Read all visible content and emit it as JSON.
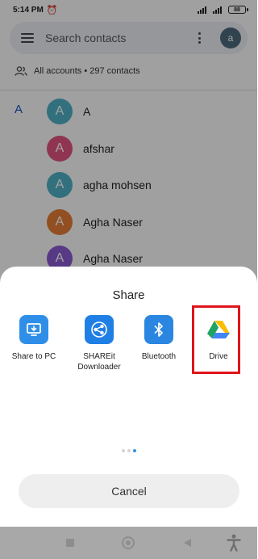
{
  "status_bar": {
    "time": "5:14 PM",
    "battery": "88"
  },
  "search": {
    "placeholder": "Search contacts",
    "avatar_letter": "a"
  },
  "accounts_summary": "All accounts • 297 contacts",
  "section_letter": "A",
  "contacts": [
    {
      "initial": "A",
      "name": "A",
      "color": "#4fb0c6"
    },
    {
      "initial": "A",
      "name": "afshar",
      "color": "#e0547f"
    },
    {
      "initial": "A",
      "name": "agha mohsen",
      "color": "#4fb0c6"
    },
    {
      "initial": "A",
      "name": "Agha Naser",
      "color": "#e57c35"
    },
    {
      "initial": "A",
      "name": "Agha Naser",
      "color": "#8a5ad1"
    }
  ],
  "share_sheet": {
    "title": "Share",
    "targets": [
      {
        "label": "Share to PC",
        "icon": "share-to-pc-icon",
        "color": "#2f8fe8"
      },
      {
        "label": "SHAREit Downloader",
        "icon": "shareit-icon",
        "color": "#1f7fe5"
      },
      {
        "label": "Bluetooth",
        "icon": "bluetooth-icon",
        "color": "#2a86e0"
      },
      {
        "label": "Drive",
        "icon": "google-drive-icon",
        "color": "#ffffff"
      }
    ],
    "highlighted": "Drive",
    "pages": 3,
    "active_page": 3,
    "cancel_label": "Cancel"
  },
  "colors": {
    "highlight": "#e0141b",
    "accent": "#3b8ee5"
  }
}
